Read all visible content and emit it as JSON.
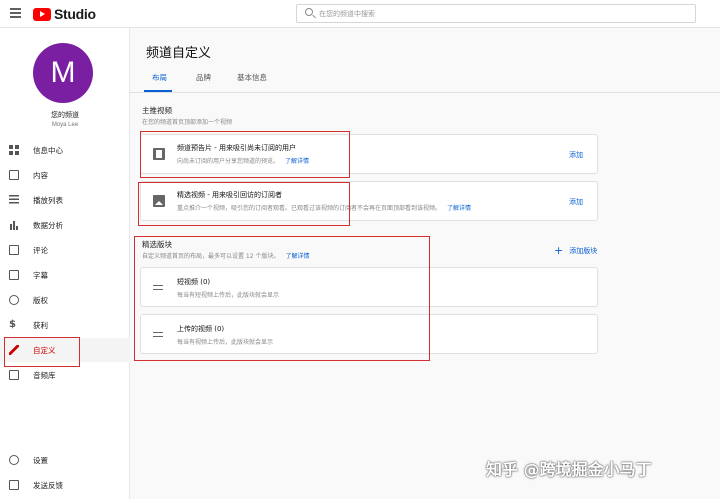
{
  "topbar": {
    "menu_icon": "hamburger-icon",
    "logo_text": "Studio",
    "search_placeholder": "在您的频道中搜索"
  },
  "channel": {
    "avatar_letter": "M",
    "avatar_color": "#7b1fa2",
    "name": "您的频道",
    "username": "Moya Lee"
  },
  "sidebar": {
    "items": [
      {
        "label": "信息中心",
        "icon": "dashboard-icon"
      },
      {
        "label": "内容",
        "icon": "content-icon"
      },
      {
        "label": "播放列表",
        "icon": "playlist-icon"
      },
      {
        "label": "数据分析",
        "icon": "analytics-icon"
      },
      {
        "label": "评论",
        "icon": "comments-icon"
      },
      {
        "label": "字幕",
        "icon": "subtitles-icon"
      },
      {
        "label": "版权",
        "icon": "copyright-icon"
      },
      {
        "label": "获利",
        "icon": "dollar-icon"
      },
      {
        "label": "自定义",
        "icon": "customize-icon"
      },
      {
        "label": "音频库",
        "icon": "audio-library-icon"
      }
    ],
    "bottom_items": [
      {
        "label": "设置",
        "icon": "gear-icon"
      },
      {
        "label": "发送反馈",
        "icon": "feedback-icon"
      }
    ]
  },
  "main": {
    "title": "频道自定义",
    "tabs": [
      {
        "label": "布局",
        "active": true
      },
      {
        "label": "品牌",
        "active": false
      },
      {
        "label": "基本信息",
        "active": false
      }
    ],
    "featured_video": {
      "title": "主推视频",
      "subtitle": "在您的频道首页顶部添加一个视频",
      "trailer": {
        "title": "频道预告片 - 用来吸引尚未订阅的用户",
        "desc": "向尚未订阅的用户分享您频道的预览。",
        "link": "了解详情",
        "action": "添加"
      },
      "featured": {
        "title": "精选视频 - 用来吸引回访的订阅者",
        "desc": "重点推介一个视频，吸引您的订阅者观看。已观看过该视频的订阅者不会再在页面顶部看到该视频。",
        "link": "了解详情",
        "action": "添加"
      }
    },
    "sections": {
      "title": "精选版块",
      "subtitle": "自定义频道首页的布局，最多可以设置 12 个版块。",
      "link": "了解详情",
      "add_label": "添加版块",
      "items": [
        {
          "title": "短视频 (0)",
          "desc": "每当有短视频上传后，此版块就会显示"
        },
        {
          "title": "上传的视频 (0)",
          "desc": "每当有视频上传后，此版块就会显示"
        }
      ]
    }
  },
  "watermark": "知乎 @跨境掘金小马丁",
  "colors": {
    "accent": "#065fd4",
    "highlight": "#d32f2f",
    "brand": "#ff0000"
  }
}
